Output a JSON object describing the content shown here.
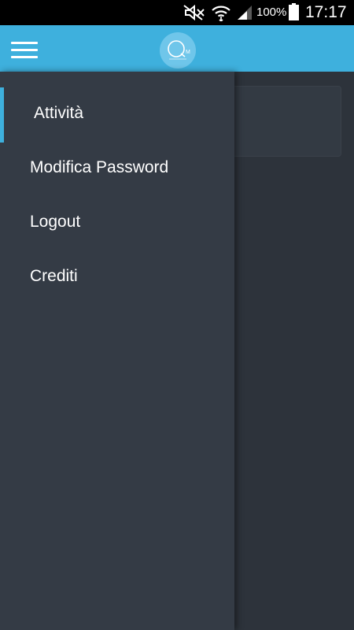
{
  "status_bar": {
    "battery_percent": "100%",
    "time": "17:17"
  },
  "app_bar": {
    "menu_icon": "hamburger-menu-icon",
    "logo_icon": "app-logo-icon",
    "accent_color": "#3eb0dd"
  },
  "drawer": {
    "items": [
      {
        "label": "Attività",
        "active": true
      },
      {
        "label": "Modifica Password",
        "active": false
      },
      {
        "label": "Logout",
        "active": false
      },
      {
        "label": "Crediti",
        "active": false
      }
    ]
  }
}
